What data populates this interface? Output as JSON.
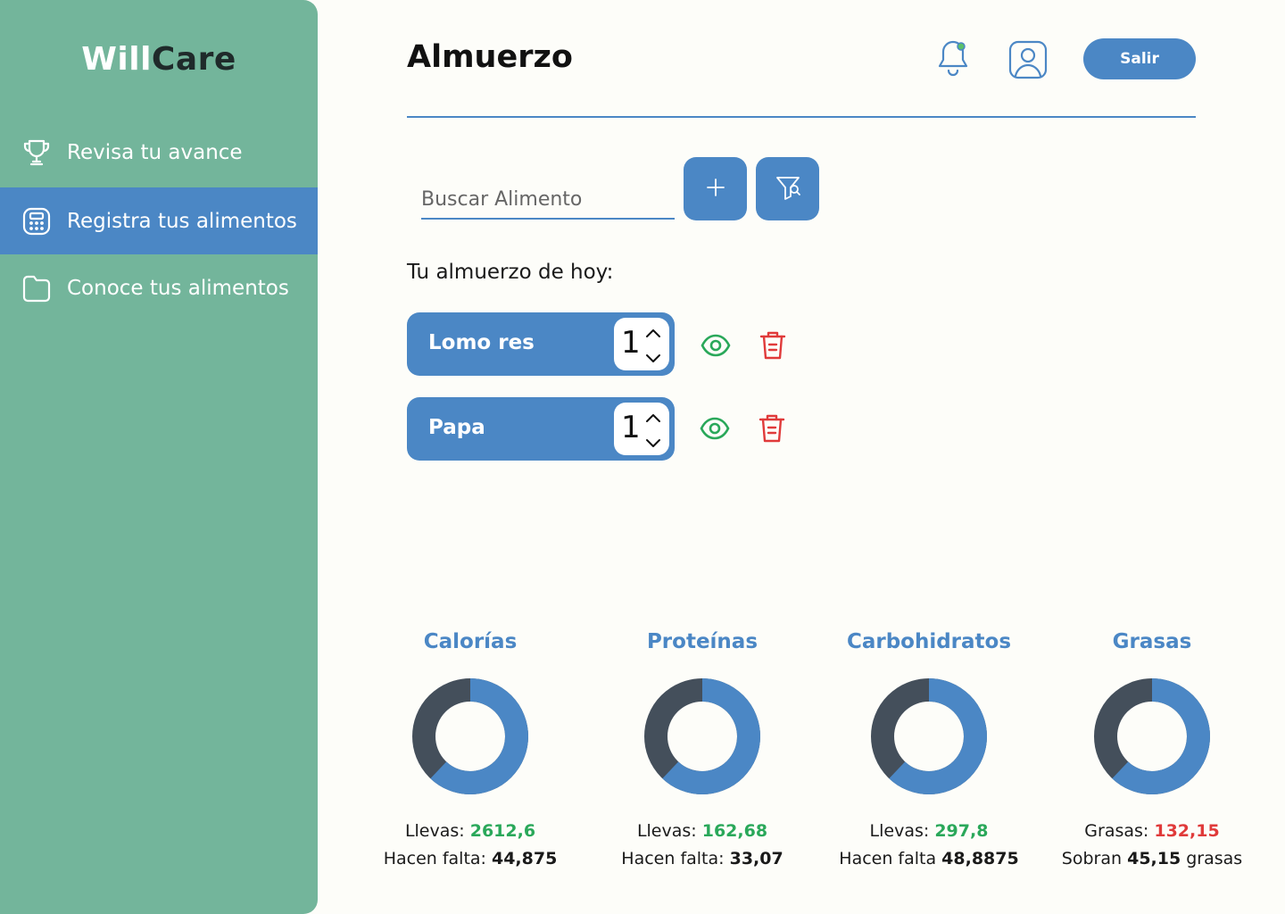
{
  "app": {
    "logo_part1": "Will",
    "logo_part2": "Care"
  },
  "sidebar": {
    "items": [
      {
        "label": "Revisa tu avance",
        "icon": "trophy-icon"
      },
      {
        "label": "Registra tus alimentos",
        "icon": "calculator-icon",
        "active": true
      },
      {
        "label": "Conoce tus alimentos",
        "icon": "folder-icon"
      }
    ]
  },
  "header": {
    "title": "Almuerzo",
    "logout_label": "Salir",
    "notification_icon": "bell-icon",
    "profile_icon": "user-icon"
  },
  "search": {
    "placeholder": "Buscar Alimento",
    "value": ""
  },
  "section_title": "Tu almuerzo de hoy:",
  "foods": [
    {
      "name": "Lomo res",
      "quantity": "1"
    },
    {
      "name": "Papa",
      "quantity": "1"
    }
  ],
  "colors": {
    "sidebar": "#73b59b",
    "accent": "#4b87c5",
    "donut_dark": "#444f5b",
    "green": "#2aa85a",
    "red": "#e03a3a"
  },
  "stats": [
    {
      "title": "Calorías",
      "line1_label": "Llevas: ",
      "line1_value": "2612,6",
      "line1_color": "green",
      "line2_label": "Hacen falta: ",
      "line2_value": "44,875",
      "line2_suffix": "",
      "progress": 0.62
    },
    {
      "title": "Proteínas",
      "line1_label": "Llevas: ",
      "line1_value": "162,68",
      "line1_color": "green",
      "line2_label": "Hacen falta: ",
      "line2_value": "33,07",
      "line2_suffix": "",
      "progress": 0.62
    },
    {
      "title": "Carbohidratos",
      "line1_label": "Llevas: ",
      "line1_value": "297,8",
      "line1_color": "green",
      "line2_label": "Hacen falta ",
      "line2_value": "48,8875",
      "line2_suffix": "",
      "progress": 0.62
    },
    {
      "title": "Grasas",
      "line1_label": "Grasas: ",
      "line1_value": "132,15",
      "line1_color": "red",
      "line2_label": "Sobran ",
      "line2_value": "45,15",
      "line2_suffix": " grasas",
      "progress": 0.62
    }
  ]
}
